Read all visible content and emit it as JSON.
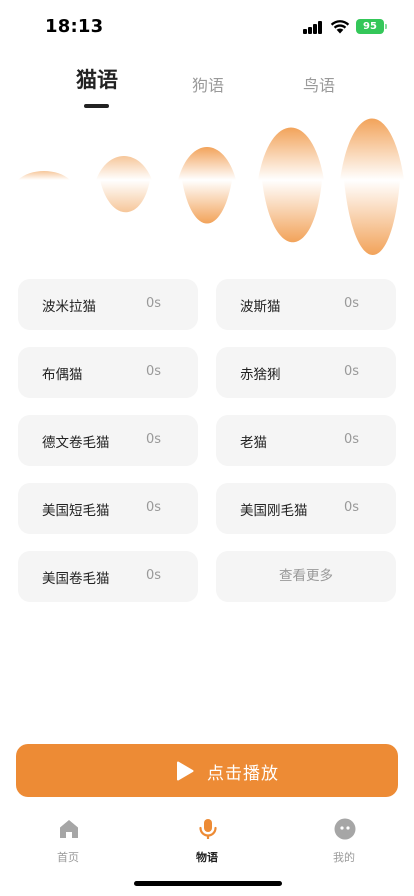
{
  "status_bar": {
    "time": "18:13",
    "battery": "95"
  },
  "tabs": [
    {
      "label": "猫语",
      "active": true
    },
    {
      "label": "狗语",
      "active": false
    },
    {
      "label": "鸟语",
      "active": false
    }
  ],
  "cards": [
    {
      "name": "波米拉猫",
      "duration": "0s"
    },
    {
      "name": "波斯猫",
      "duration": "0s"
    },
    {
      "name": "布偶猫",
      "duration": "0s"
    },
    {
      "name": "赤猞猁",
      "duration": "0s"
    },
    {
      "name": "德文卷毛猫",
      "duration": "0s"
    },
    {
      "name": "老猫",
      "duration": "0s"
    },
    {
      "name": "美国短毛猫",
      "duration": "0s"
    },
    {
      "name": "美国刚毛猫",
      "duration": "0s"
    },
    {
      "name": "美国卷毛猫",
      "duration": "0s"
    }
  ],
  "more_label": "查看更多",
  "play_button": {
    "label": "点击播放"
  },
  "nav": [
    {
      "label": "首页",
      "icon": "home-icon",
      "active": false
    },
    {
      "label": "物语",
      "icon": "microphone-icon",
      "active": true
    },
    {
      "label": "我的",
      "icon": "profile-icon",
      "active": false
    }
  ],
  "colors": {
    "accent": "#ed8b35",
    "wave": "#f2a35a",
    "card_bg": "#f5f5f5",
    "battery": "#34c759"
  }
}
